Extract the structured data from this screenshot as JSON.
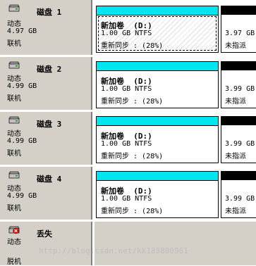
{
  "disks": [
    {
      "title": "磁盘 1",
      "type": "动态",
      "size": "4.97 GB",
      "status": "联机",
      "volume": {
        "name": "新加卷  (D:)",
        "size": "1.00 GB NTFS",
        "state": "重新同步 : (28%)"
      },
      "unalloc": {
        "size": "3.97 GB",
        "label": "未指派"
      }
    },
    {
      "title": "磁盘 2",
      "type": "动态",
      "size": "4.99 GB",
      "status": "联机",
      "volume": {
        "name": "新加卷  (D:)",
        "size": "1.00 GB NTFS",
        "state": "重新同步 : (28%)"
      },
      "unalloc": {
        "size": "3.99 GB",
        "label": "未指派"
      }
    },
    {
      "title": "磁盘 3",
      "type": "动态",
      "size": "4.99 GB",
      "status": "联机",
      "volume": {
        "name": "新加卷  (D:)",
        "size": "1.00 GB NTFS",
        "state": "重新同步 : (28%)"
      },
      "unalloc": {
        "size": "3.99 GB",
        "label": "未指派"
      }
    },
    {
      "title": "磁盘 4",
      "type": "动态",
      "size": "4.99 GB",
      "status": "联机",
      "volume": {
        "name": "新加卷  (D:)",
        "size": "1.00 GB NTFS",
        "state": "重新同步 : (28%)"
      },
      "unalloc": {
        "size": "3.99 GB",
        "label": "未指派"
      }
    }
  ],
  "missing": {
    "title": "丢失",
    "type": "动态",
    "status": "脱机"
  },
  "watermark": "http://blog.csdn.net/kk185800961",
  "colors": {
    "volume_bar": "#00e6f0",
    "unalloc_bar": "#000000",
    "panel": "#d4d0c8"
  }
}
